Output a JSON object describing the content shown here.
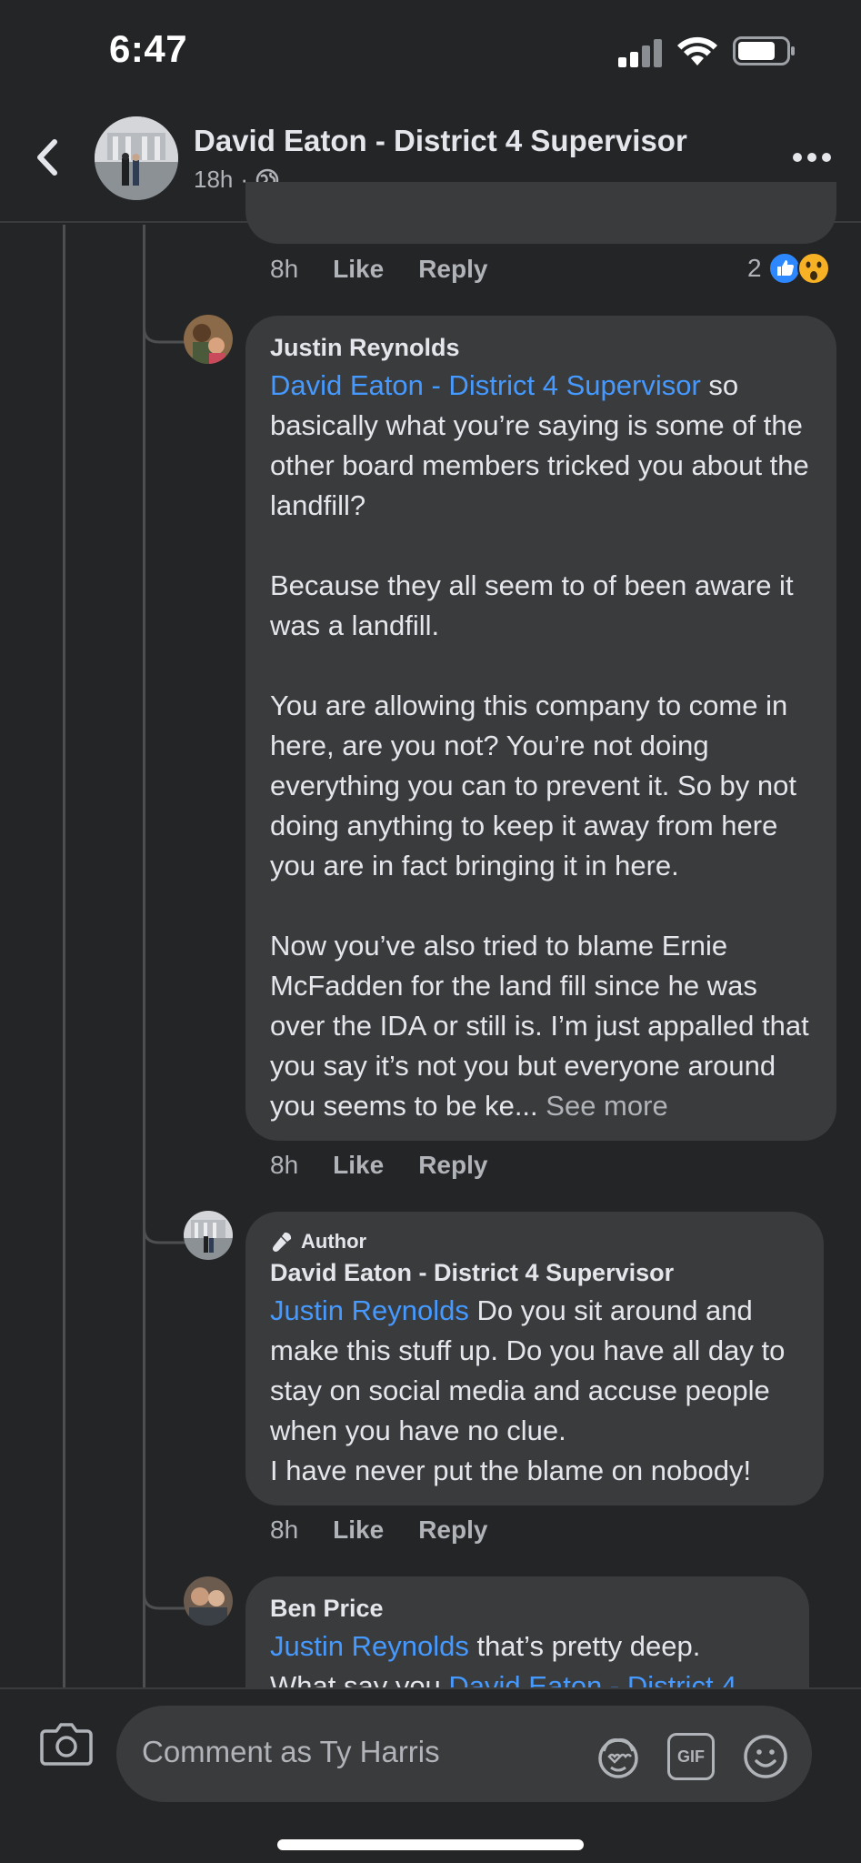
{
  "status_bar": {
    "time": "6:47"
  },
  "header": {
    "title": "David Eaton - District 4 Supervisor",
    "time": "18h",
    "separator": "·"
  },
  "top_comment_actions": {
    "time": "8h",
    "like": "Like",
    "reply": "Reply",
    "reaction_count": "2"
  },
  "comments": [
    {
      "author": "Justin Reynolds",
      "mention": "David Eaton - District 4 Supervisor",
      "lines_after_mention": " so",
      "paragraphs": [
        "basically what you’re saying is some of the other board members tricked you about the landfill?",
        "Because they all seem to of been aware it was a landfill.",
        "You are allowing this company to come in here, are you not? You’re not doing everything you can to prevent it. So by not doing anything to keep it away from here you are in fact bringing it in here.",
        "Now you’ve also tried to blame Ernie McFadden for the land fill since he was over the IDA or still is. I’m just appalled that you say it’s not you but everyone around you seems to be ke..."
      ],
      "see_more": "See more",
      "time": "8h",
      "like": "Like",
      "reply": "Reply"
    },
    {
      "badge": "Author",
      "author": "David Eaton - District 4 Supervisor",
      "mention": "Justin Reynolds",
      "text": " Do you sit around and make this stuff up. Do you have all day to stay on social media and accuse people when you have no clue.",
      "text2": "I have never put the blame on nobody!",
      "time": "8h",
      "like": "Like",
      "reply": "Reply"
    },
    {
      "author": "Ben Price",
      "mention": "Justin Reynolds",
      "text": " that’s pretty deep.",
      "text2": "What say you ",
      "mention2": "David Eaton - District 4"
    }
  ],
  "composer": {
    "placeholder": "Comment as Ty Harris",
    "gif": "GIF"
  },
  "colors": {
    "background": "#242526",
    "bubble": "#3a3b3c",
    "mention": "#4599ff",
    "secondary_text": "#b0b3b8"
  }
}
